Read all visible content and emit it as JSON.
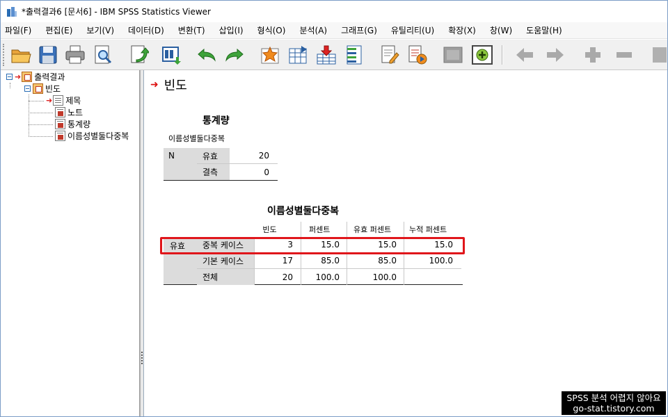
{
  "window": {
    "title": "*출력결과6 [문서6] - IBM SPSS Statistics Viewer"
  },
  "menu": [
    "파일(F)",
    "편집(E)",
    "보기(V)",
    "데이터(D)",
    "변환(T)",
    "삽입(I)",
    "형식(O)",
    "분석(A)",
    "그래프(G)",
    "유틸리티(U)",
    "확장(X)",
    "창(W)",
    "도움말(H)"
  ],
  "toolbar": {
    "icons": [
      "open-folder-icon",
      "save-icon",
      "print-icon",
      "print-preview-icon",
      "export-icon",
      "recall-dialog-icon",
      "undo-icon",
      "redo-icon",
      "goto-data-icon",
      "goto-case-icon",
      "goto-variable-icon",
      "variables-icon",
      "designate-window-icon",
      "run-script-icon",
      "hide-icon",
      "add-icon",
      "back-icon",
      "forward-icon",
      "expand-icon",
      "collapse-icon",
      "show-icon"
    ]
  },
  "outline": {
    "root": "출력결과",
    "group": "빈도",
    "items": [
      "제목",
      "노트",
      "통계량",
      "이름성별둘다중복"
    ]
  },
  "content": {
    "heading": "빈도",
    "stats_table": {
      "title": "통계량",
      "subtitle": "이름성별둘다중복",
      "row_label": "N",
      "rows": [
        {
          "label": "유효",
          "value": "20"
        },
        {
          "label": "결측",
          "value": "0"
        }
      ]
    },
    "freq_table": {
      "title": "이름성별둘다중복",
      "headers": [
        "빈도",
        "퍼센트",
        "유효 퍼센트",
        "누적 퍼센트"
      ],
      "group_label": "유효",
      "rows": [
        {
          "label": "중복 케이스",
          "freq": "3",
          "pct": "15.0",
          "valid_pct": "15.0",
          "cum_pct": "15.0"
        },
        {
          "label": "기본 케이스",
          "freq": "17",
          "pct": "85.0",
          "valid_pct": "85.0",
          "cum_pct": "100.0"
        },
        {
          "label": "전체",
          "freq": "20",
          "pct": "100.0",
          "valid_pct": "100.0",
          "cum_pct": ""
        }
      ]
    }
  },
  "watermark": {
    "line1": "SPSS 분석 어렵지 않아요",
    "line2": "go-stat.tistory.com"
  },
  "colors": {
    "highlight": "#e0161b",
    "table_shade": "#dcdcdc",
    "accent_arrow": "#d11111"
  }
}
